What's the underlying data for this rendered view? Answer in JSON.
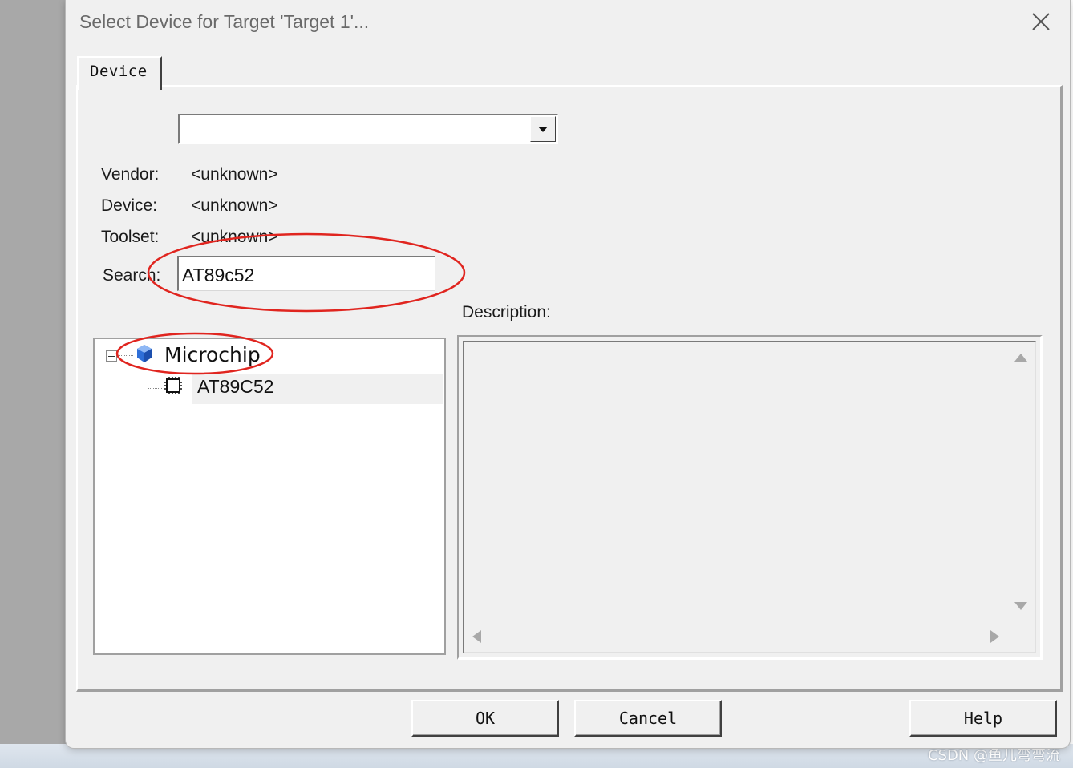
{
  "dialog": {
    "title": "Select Device for Target 'Target 1'...",
    "close_icon": "close-icon"
  },
  "tabs": [
    {
      "label": "Device",
      "active": true
    }
  ],
  "device_combo": {
    "selected": ""
  },
  "info": {
    "vendor_label": "Vendor:",
    "vendor_value": "<unknown>",
    "device_label": "Device:",
    "device_value": "<unknown>",
    "toolset_label": "Toolset:",
    "toolset_value": "<unknown>",
    "search_label": "Search:",
    "search_value": "AT89c52"
  },
  "tree": {
    "vendor": {
      "label": "Microchip",
      "icon": "vendor-icon",
      "expanded": true
    },
    "devices": [
      {
        "label": "AT89C52",
        "icon": "chip-icon",
        "selected": true
      }
    ]
  },
  "description": {
    "label": "Description:",
    "text": ""
  },
  "buttons": {
    "ok": "OK",
    "cancel": "Cancel",
    "help": "Help"
  },
  "watermark": "CSDN @鱼儿弯弯流",
  "colors": {
    "annotation": "#e0251f",
    "vendor_icon": "#2e6fd8"
  }
}
